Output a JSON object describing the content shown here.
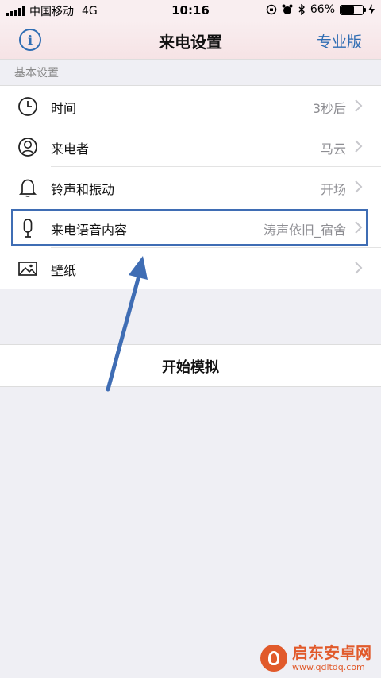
{
  "status_bar": {
    "carrier": "中国移动",
    "network": "4G",
    "time": "10:16",
    "battery_percent": "66%",
    "battery_level": 0.66
  },
  "nav": {
    "title": "来电设置",
    "right_button": "专业版"
  },
  "section_header": "基本设置",
  "settings": [
    {
      "icon": "clock-icon",
      "label": "时间",
      "value": "3秒后"
    },
    {
      "icon": "person-icon",
      "label": "来电者",
      "value": "马云"
    },
    {
      "icon": "bell-icon",
      "label": "铃声和振动",
      "value": "开场"
    },
    {
      "icon": "microphone-icon",
      "label": "来电语音内容",
      "value": "涛声依旧_宿舍"
    },
    {
      "icon": "picture-icon",
      "label": "壁纸",
      "value": ""
    }
  ],
  "start_button": "开始模拟",
  "watermark": {
    "name": "启东安卓网",
    "url": "www.qdltdq.com"
  },
  "colors": {
    "accent": "#2f6db3",
    "highlight": "#3f6db4",
    "nav_background": "#f6e3e5",
    "page_background": "#efeff4"
  }
}
